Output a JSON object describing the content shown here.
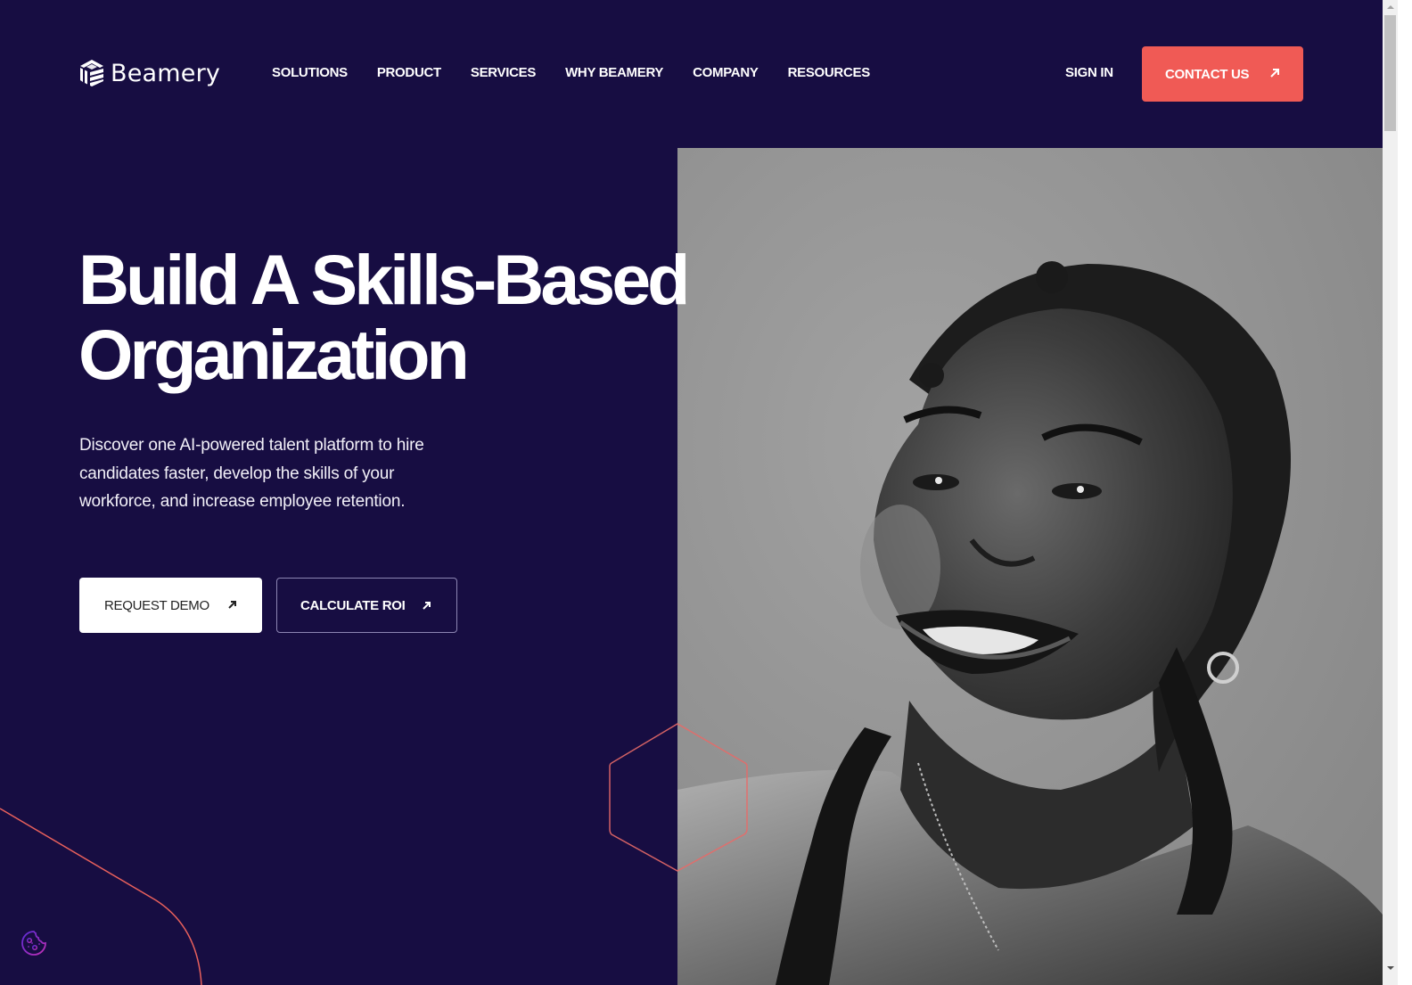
{
  "brand": {
    "name": "Beamery",
    "logo_icon": "beamery-cube-icon"
  },
  "nav": {
    "items": [
      {
        "label": "SOLUTIONS"
      },
      {
        "label": "PRODUCT"
      },
      {
        "label": "SERVICES"
      },
      {
        "label": "WHY BEAMERY"
      },
      {
        "label": "COMPANY"
      },
      {
        "label": "RESOURCES"
      }
    ],
    "sign_in": "SIGN IN",
    "contact": {
      "label": "CONTACT US",
      "icon": "arrow-up-right-icon"
    }
  },
  "hero": {
    "title_line1": "Build A Skills-Based",
    "title_line2": "Organization",
    "subtitle": "Discover one AI-powered talent platform to hire candidates faster, develop the skills of your workforce, and increase employee retention.",
    "buttons": [
      {
        "label": "REQUEST DEMO",
        "icon": "arrow-up-right-icon"
      },
      {
        "label": "CALCULATE ROI",
        "icon": "arrow-up-right-icon"
      }
    ],
    "image_alt": "Black and white portrait of a smiling woman with braided hair"
  },
  "cookie": {
    "icon": "cookie-icon"
  },
  "colors": {
    "background": "#170d42",
    "accent": "#f05a55",
    "text": "#ffffff"
  }
}
